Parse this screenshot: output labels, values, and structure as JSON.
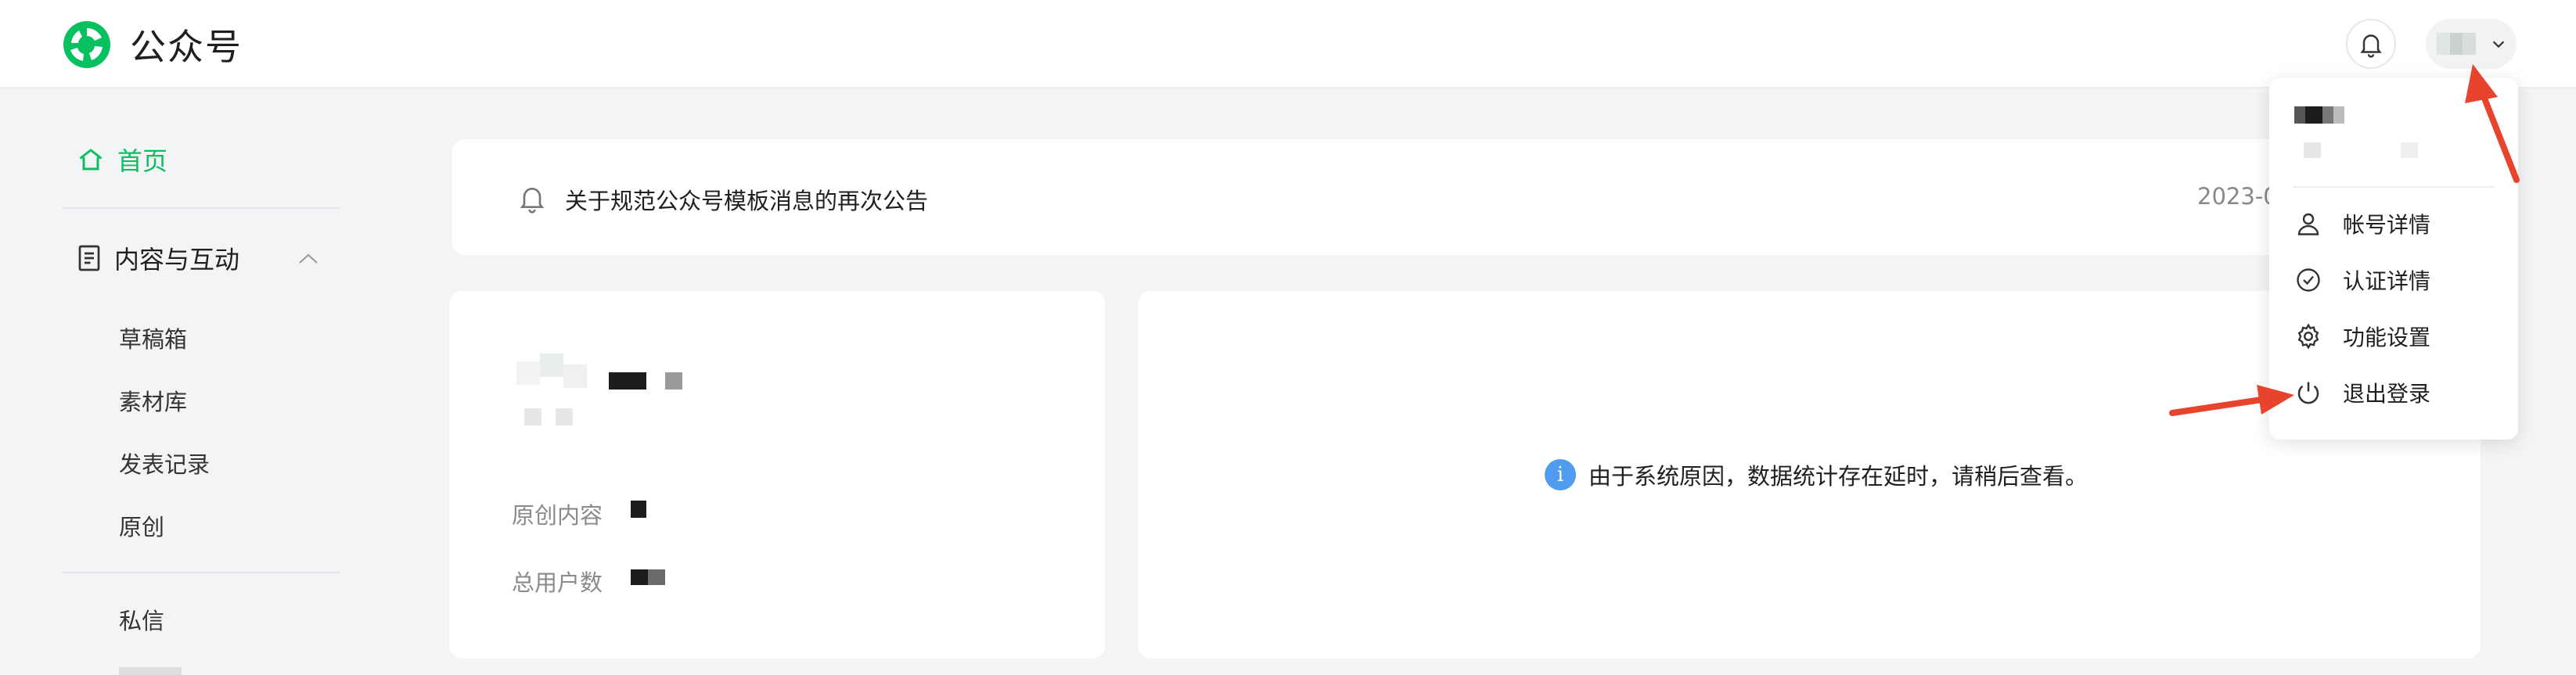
{
  "header": {
    "app_name": "公众号",
    "brand_color": "#07c160",
    "icons": {
      "logo": "wechat-mp-logo",
      "bell": "bell-icon",
      "chevron": "chevron-down-icon"
    }
  },
  "sidebar": {
    "home_label": "首页",
    "group_label": "内容与互动",
    "sub_items": [
      "草稿箱",
      "素材库",
      "发表记录",
      "原创"
    ],
    "after_divider": [
      "私信"
    ]
  },
  "notice": {
    "text": "关于规范公众号模板消息的再次公告",
    "date": "2023-0"
  },
  "account_card": {
    "stats": [
      {
        "label": "原创内容"
      },
      {
        "label": "总用户数"
      }
    ]
  },
  "data_card": {
    "message": "由于系统原因，数据统计存在延时，请稍后查看。",
    "info_icon": "i"
  },
  "account_menu": {
    "items": [
      {
        "label": "帐号详情",
        "icon": "user-icon"
      },
      {
        "label": "认证详情",
        "icon": "check-circle-icon"
      },
      {
        "label": "功能设置",
        "icon": "gear-icon"
      },
      {
        "label": "退出登录",
        "icon": "power-icon"
      }
    ]
  },
  "annotations": {
    "arrow_color": "#e8432d"
  }
}
